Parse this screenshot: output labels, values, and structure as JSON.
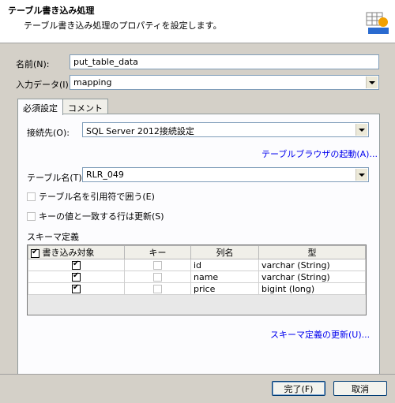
{
  "header": {
    "title": "テーブル書き込み処理",
    "description": "テーブル書き込み処理のプロパティを設定します。"
  },
  "fields": {
    "name_label": "名前(N):",
    "name_value": "put_table_data",
    "input_label": "入力データ(I):",
    "input_value": "mapping"
  },
  "tabs": [
    {
      "label": "必須設定"
    },
    {
      "label": "コメント"
    }
  ],
  "required": {
    "connection_label": "接続先(O):",
    "connection_value": "SQL Server 2012接続設定",
    "browser_link": "テーブルブラウザの起動(A)...",
    "table_label": "テーブル名(T):",
    "table_value": "RLR_049",
    "quote_checkbox": "テーブル名を引用符で囲う(E)",
    "update_checkbox": "キーの値と一致する行は更新(S)",
    "schema_label": "スキーマ定義",
    "schema_update_link": "スキーマ定義の更新(U)..."
  },
  "schema_table": {
    "headers": [
      "書き込み対象",
      "キー",
      "列名",
      "型"
    ],
    "rows": [
      {
        "write": true,
        "key": false,
        "column": "id",
        "type": "varchar (String)"
      },
      {
        "write": true,
        "key": false,
        "column": "name",
        "type": "varchar (String)"
      },
      {
        "write": true,
        "key": false,
        "column": "price",
        "type": "bigint (long)"
      }
    ]
  },
  "buttons": {
    "ok": "完了(F)",
    "cancel": "取消"
  }
}
